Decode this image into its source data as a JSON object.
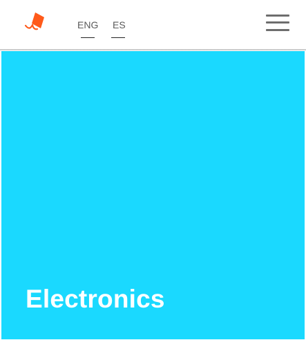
{
  "header": {
    "logo_icon": "orange-kite-logo-icon",
    "languages": [
      {
        "label": "ENG"
      },
      {
        "label": "ES"
      }
    ],
    "menu_icon": "hamburger-menu-icon"
  },
  "hero": {
    "title": "Electronics",
    "background_color": "#1ad9ff"
  },
  "colors": {
    "brand_accent": "#ff5a1a",
    "text_muted": "#5a5a5a",
    "hero_text": "#ffffff"
  }
}
